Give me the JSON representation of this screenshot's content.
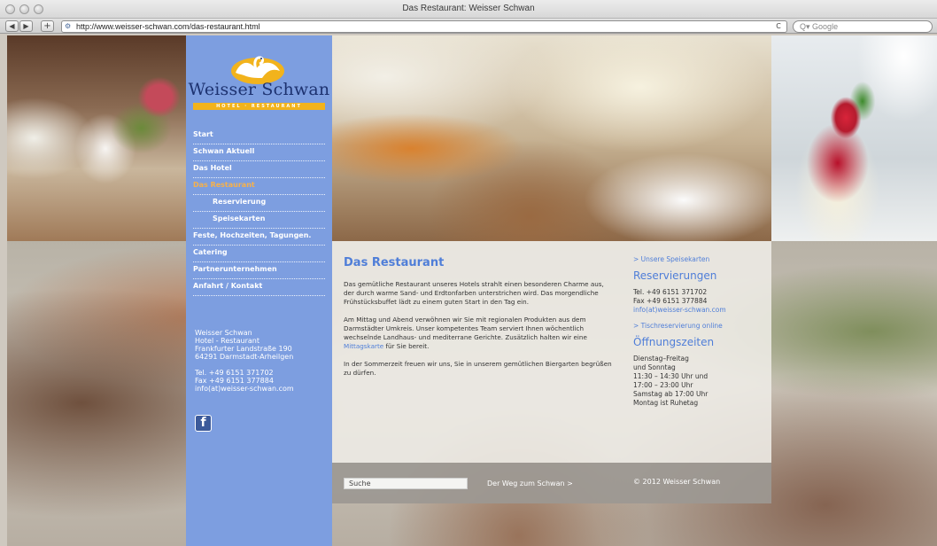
{
  "browser": {
    "title": "Das Restaurant: Weisser Schwan",
    "url": "http://www.weisser-schwan.com/das-restaurant.html",
    "search_placeholder": "Google",
    "search_prefix": "Q▾",
    "back_icon": "◀",
    "forward_icon": "▶",
    "add_icon": "+",
    "reload_icon": "C"
  },
  "logo": {
    "name": "Weisser Schwan",
    "tagline": "HOTEL · RESTAURANT"
  },
  "nav": {
    "items": [
      {
        "label": "Start"
      },
      {
        "label": "Schwan Aktuell"
      },
      {
        "label": "Das Hotel"
      },
      {
        "label": "Das Restaurant"
      },
      {
        "label": "Reservierung"
      },
      {
        "label": "Speisekarten"
      },
      {
        "label": "Feste, Hochzeiten, Tagungen."
      },
      {
        "label": "Catering"
      },
      {
        "label": "Partnerunternehmen"
      },
      {
        "label": "Anfahrt / Kontakt"
      }
    ],
    "active": "Das Restaurant"
  },
  "address": {
    "name": "Weisser Schwan",
    "type": "Hotel - Restaurant",
    "street": "Frankfurter Landstraße 190",
    "city": "64291 Darmstadt-Arheilgen",
    "tel": "Tel. +49 6151 371702",
    "fax": "Fax +49 6151 377884",
    "email": "info(at)weisser-schwan.com"
  },
  "social": {
    "facebook_label": "f"
  },
  "content": {
    "title": "Das Restaurant",
    "p1": "Das gemütliche Restaurant unseres Hotels strahlt einen besonderen Charme aus, der durch warme Sand- und Erdtonfarben unterstrichen wird. Das morgendliche Frühstücksbuffet lädt zu einem guten Start in den Tag ein.",
    "p2_start": "Am Mittag und Abend verwöhnen wir Sie mit regionalen Produkten aus dem Darmstädter Umkreis. Unser kompetentes Team serviert Ihnen wöchentlich wechselnde Landhaus- und mediterrane Gerichte. Zusätzlich halten wir eine ",
    "p2_link": "Mittagskarte",
    "p2_end": " für Sie bereit.",
    "p3": "In der Sommerzeit freuen wir uns, Sie in unserem gemütlichen Biergarten begrüßen zu dürfen."
  },
  "aside": {
    "menu_link": "> Unsere Speisekarten",
    "reservations_title": "Reservierungen",
    "tel": "Tel. +49 6151 371702",
    "fax": "Fax +49 6151 377884",
    "email": "info(at)weisser-schwan.com",
    "online_link": "> Tischreservierung online",
    "hours_title": "Öffnungszeiten",
    "hours": [
      "Dienstag–Freitag",
      "und Sonntag",
      "11:30 – 14:30 Uhr und",
      "17:00 – 23:00 Uhr",
      "Samstag ab 17:00 Uhr",
      "Montag ist Ruhetag"
    ]
  },
  "footer": {
    "search_value": "Suche",
    "way_link": "Der Weg zum Schwan >",
    "copyright": "© 2012 Weisser Schwan"
  },
  "colors": {
    "sidebar": "#7d9ee0",
    "accent_blue": "#4f7ed8",
    "active_orange": "#f6b14b",
    "logo_gold": "#f2b31c"
  }
}
